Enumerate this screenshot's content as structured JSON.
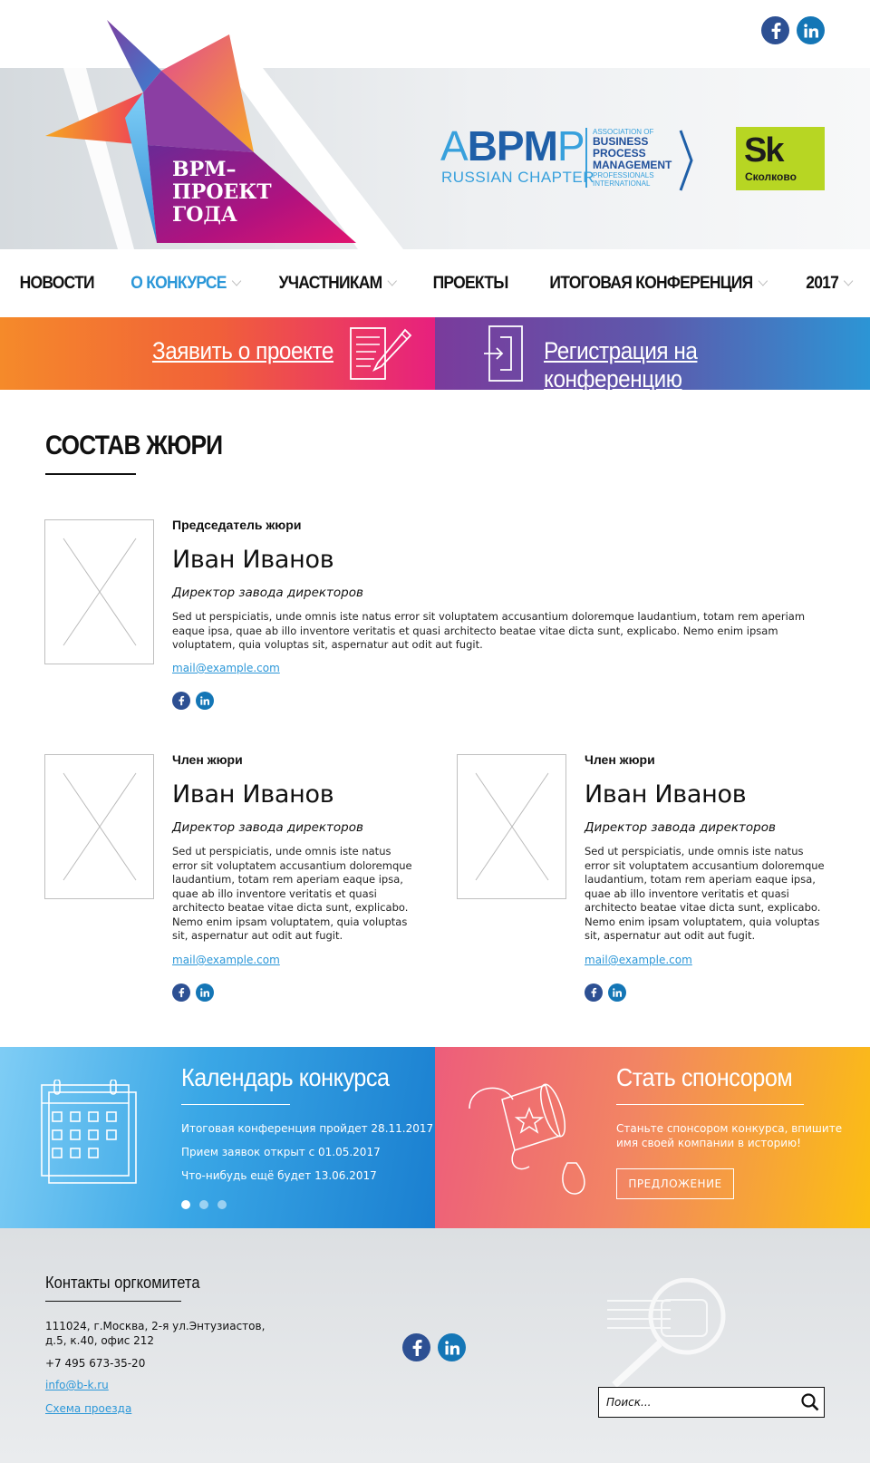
{
  "header": {
    "logo_text": "BPM–ПРОЕКТ ГОДА",
    "logo_lines": [
      "BPM–",
      "ПРОЕКТ",
      "ГОДА"
    ],
    "abpmp": {
      "letters": "ABPMP",
      "chapter": "RUSSIAN CHAPTER",
      "lines": [
        "ASSOCIATION OF",
        "BUSINESS",
        "PROCESS",
        "MANAGEMENT",
        "PROFESSIONALS",
        "INTERNATIONAL"
      ]
    },
    "skolkovo": {
      "mark": "Sk",
      "name": "Сколково",
      "color": "#b7d623"
    },
    "social": [
      "facebook-icon",
      "linkedin-icon"
    ]
  },
  "nav": {
    "items": [
      {
        "label": "НОВОСТИ",
        "dropdown": false,
        "active": false
      },
      {
        "label": "О КОНКУРСЕ",
        "dropdown": true,
        "active": true
      },
      {
        "label": "УЧАСТНИКАМ",
        "dropdown": true,
        "active": false
      },
      {
        "label": "ПРОЕКТЫ",
        "dropdown": false,
        "active": false
      },
      {
        "label": "ИТОГОВАЯ КОНФЕРЕНЦИЯ",
        "dropdown": true,
        "active": false
      },
      {
        "label": "2017",
        "dropdown": true,
        "active": false
      }
    ],
    "active_color": "#2b97d8"
  },
  "banners": {
    "left": {
      "label": "Заявить о проекте",
      "icon": "document-pen-icon"
    },
    "right": {
      "label": "Регистрация на конференцию",
      "icon": "door-enter-icon"
    }
  },
  "jury": {
    "title": "СОСТАВ ЖЮРИ",
    "chair": {
      "role": "Председатель жюри",
      "name": "Иван Иванов",
      "position": "Директор завода директоров",
      "description": "Sed ut perspiciatis, unde omnis iste natus error sit voluptatem accusantium doloremque laudantium, totam rem aperiam eaque ipsa, quae ab illo inventore veritatis et quasi architecto beatae vitae dicta sunt, explicabo. Nemo enim ipsam voluptatem, quia voluptas sit, aspernatur aut odit aut fugit.",
      "email": "mail@example.com"
    },
    "members": [
      {
        "role": "Член жюри",
        "name": "Иван Иванов",
        "position": "Директор завода директоров",
        "description": "Sed ut perspiciatis, unde omnis iste natus error sit voluptatem accusantium doloremque laudantium, totam rem aperiam eaque ipsa, quae ab illo inventore veritatis et quasi architecto beatae vitae dicta sunt, explicabo. Nemo enim ipsam voluptatem, quia voluptas sit, aspernatur aut odit aut fugit.",
        "email": "mail@example.com"
      },
      {
        "role": "Член жюри",
        "name": "Иван Иванов",
        "position": "Директор завода директоров",
        "description": "Sed ut perspiciatis, unde omnis iste natus error sit voluptatem accusantium doloremque laudantium, totam rem aperiam eaque ipsa, quae ab illo inventore veritatis et quasi architecto beatae vitae dicta sunt, explicabo. Nemo enim ipsam voluptatem, quia voluptas sit, aspernatur aut odit aut fugit.",
        "email": "mail@example.com"
      }
    ]
  },
  "calendar": {
    "title": "Календарь конкурса",
    "events": [
      "Итоговая конференция пройдет 28.11.2017",
      "Прием заявок открыт с 01.05.2017",
      "Что-нибудь ещё будет 13.06.2017"
    ],
    "slides": 3,
    "active_slide": 1
  },
  "sponsor": {
    "title": "Стать спонсором",
    "text": "Станьте спонсором конкурса, впишите имя своей компании в историю!",
    "button": "ПРЕДЛОЖЕНИЕ"
  },
  "footer": {
    "title": "Контакты оргкомитета",
    "address_line1": "111024, г.Москва, 2-я ул.Энтузиастов,",
    "address_line2": "д.5, к.40, офис 212",
    "phone": "+7 495 673-35-20",
    "email": "info@b-k.ru",
    "map_link": "Схема проезда",
    "search_placeholder": "Поиск..."
  },
  "colors": {
    "accent": "#2b97d8",
    "facebook": "#2d5093",
    "linkedin": "#1476b6"
  }
}
